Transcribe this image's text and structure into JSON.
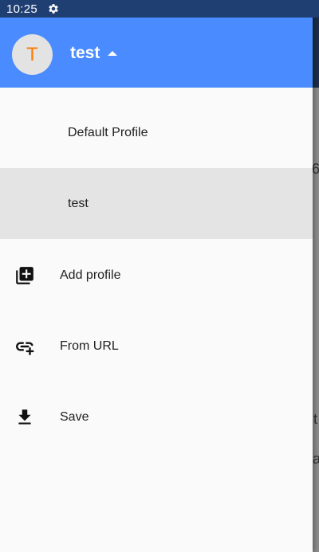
{
  "status_bar": {
    "time": "10:25",
    "settings_icon": "gear-icon"
  },
  "drawer": {
    "header": {
      "avatar_initial": "T",
      "account_name": "test",
      "expand_icon": "caret-up-icon"
    },
    "profiles": [
      {
        "label": "Default Profile",
        "selected": false
      },
      {
        "label": "test",
        "selected": true
      }
    ],
    "actions": [
      {
        "label": "Add profile",
        "icon": "add-box-icon"
      },
      {
        "label": "From URL",
        "icon": "link-add-icon"
      },
      {
        "label": "Save",
        "icon": "download-icon"
      }
    ]
  },
  "background_app": {
    "peek_texts": [
      "6",
      "t",
      "a"
    ]
  },
  "colors": {
    "header": "#4a8cff",
    "status_bar": "#1f3f73",
    "avatar_text": "#ff7a00",
    "selected_row": "#e4e4e4"
  }
}
